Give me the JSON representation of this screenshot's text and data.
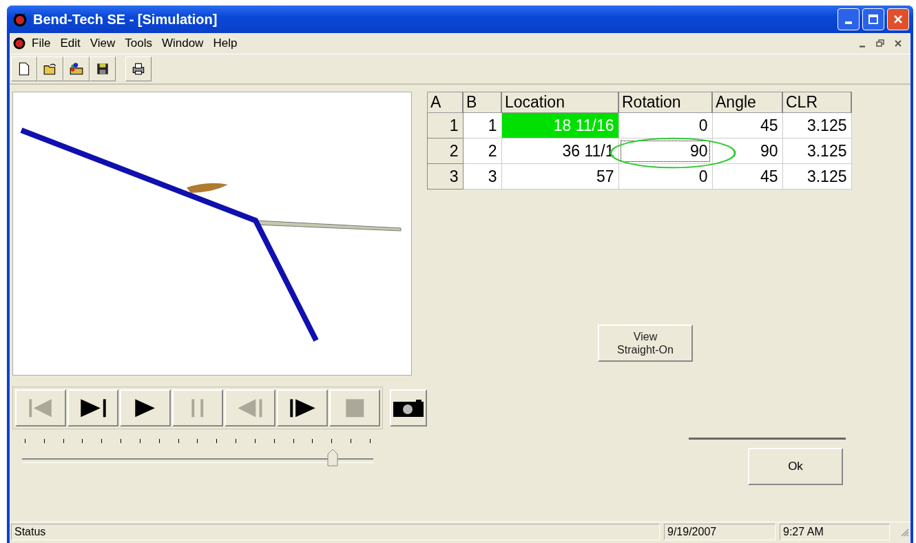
{
  "window": {
    "title": "Bend-Tech SE - [Simulation]"
  },
  "menu": [
    "File",
    "Edit",
    "View",
    "Tools",
    "Window",
    "Help"
  ],
  "toolbar": [
    {
      "kind": "new"
    },
    {
      "kind": "open"
    },
    {
      "kind": "open-color"
    },
    {
      "kind": "save"
    },
    {
      "kind": "print"
    }
  ],
  "table": {
    "columns": [
      "A",
      "B",
      "Location",
      "Rotation",
      "Angle",
      "CLR"
    ],
    "rows": [
      {
        "cells": [
          {
            "text": "1",
            "selected": false,
            "focused": false
          },
          {
            "text": "1",
            "selected": false,
            "focused": false
          },
          {
            "text": "18  11/16",
            "selected": true,
            "focused": false
          },
          {
            "text": "0",
            "selected": false,
            "focused": false
          },
          {
            "text": "45",
            "selected": false,
            "focused": false
          },
          {
            "text": "3.125",
            "selected": false,
            "focused": false
          }
        ]
      },
      {
        "cells": [
          {
            "text": "2",
            "selected": false,
            "focused": false
          },
          {
            "text": "2",
            "selected": false,
            "focused": false
          },
          {
            "text": "36  11/1",
            "selected": false,
            "focused": false
          },
          {
            "text": "90",
            "selected": false,
            "focused": true
          },
          {
            "text": "90",
            "selected": false,
            "focused": false
          },
          {
            "text": "3.125",
            "selected": false,
            "focused": false
          }
        ]
      },
      {
        "cells": [
          {
            "text": "3",
            "selected": false,
            "focused": false
          },
          {
            "text": "3",
            "selected": false,
            "focused": false
          },
          {
            "text": "57",
            "selected": false,
            "focused": false
          },
          {
            "text": "0",
            "selected": false,
            "focused": false
          },
          {
            "text": "45",
            "selected": false,
            "focused": false
          },
          {
            "text": "3.125",
            "selected": false,
            "focused": false
          }
        ]
      }
    ]
  },
  "transport": [
    {
      "kind": "first",
      "disabled": true
    },
    {
      "kind": "step-to-end",
      "disabled": false
    },
    {
      "kind": "play",
      "disabled": false
    },
    {
      "kind": "pause",
      "disabled": true
    },
    {
      "kind": "step-back",
      "disabled": true
    },
    {
      "kind": "step-forward",
      "disabled": false
    },
    {
      "kind": "stop",
      "disabled": true
    }
  ],
  "timeline": {
    "level": 0.885
  },
  "view_button": "View\nStraight-On",
  "ok_button": "Ok",
  "status_bar": [
    "Status",
    "9/19/2007",
    "9:27 AM"
  ]
}
